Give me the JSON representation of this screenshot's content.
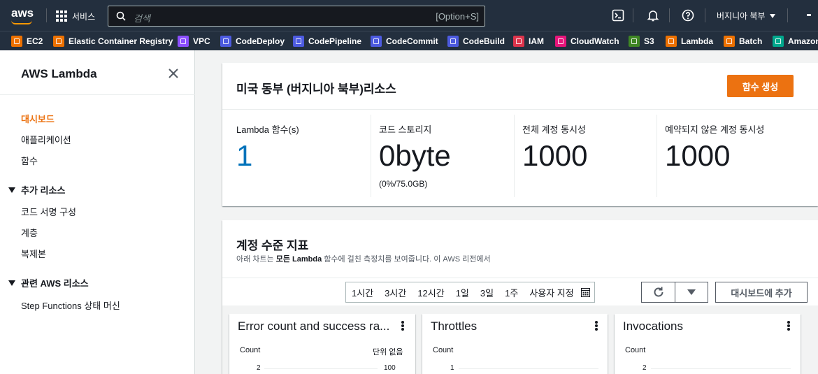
{
  "topnav": {
    "logo": "aws",
    "services_label": "서비스",
    "search_placeholder": "검색",
    "search_shortcut": "[Option+S]",
    "region_label": "버지니아 북부",
    "icons": [
      "cloudshell-icon",
      "notifications-icon",
      "help-icon"
    ]
  },
  "favorites": [
    {
      "label": "EC2",
      "color": "#ed7100"
    },
    {
      "label": "Elastic Container Registry",
      "color": "#ed7100"
    },
    {
      "label": "VPC",
      "color": "#8c4fff"
    },
    {
      "label": "CodeDeploy",
      "color": "#4d5be0"
    },
    {
      "label": "CodePipeline",
      "color": "#4d5be0"
    },
    {
      "label": "CodeCommit",
      "color": "#4d5be0"
    },
    {
      "label": "CodeBuild",
      "color": "#4d5be0"
    },
    {
      "label": "IAM",
      "color": "#dd344c"
    },
    {
      "label": "CloudWatch",
      "color": "#e7157b"
    },
    {
      "label": "S3",
      "color": "#3f8624"
    },
    {
      "label": "Lambda",
      "color": "#ed7100"
    },
    {
      "label": "Batch",
      "color": "#ed7100"
    },
    {
      "label": "Amazon",
      "color": "#01a88d"
    }
  ],
  "sidebar": {
    "title": "AWS Lambda",
    "items": [
      {
        "label": "대시보드",
        "active": true
      },
      {
        "label": "애플리케이션"
      },
      {
        "label": "함수"
      }
    ],
    "section_extra": {
      "label": "추가 리소스",
      "items": [
        {
          "label": "코드 서명 구성"
        },
        {
          "label": "계층"
        },
        {
          "label": "복제본"
        }
      ]
    },
    "section_related": {
      "label": "관련 AWS 리소스",
      "items": [
        {
          "label": "Step Functions 상태 머신"
        }
      ]
    }
  },
  "resources": {
    "title": "미국 동부 (버지니아 북부)리소스",
    "create_button": "함수 생성",
    "metrics": [
      {
        "label": "Lambda 함수(s)",
        "value": "1"
      },
      {
        "label": "코드 스토리지",
        "value": "0byte",
        "sub": "(0%/75.0GB)"
      },
      {
        "label": "전체 계정 동시성",
        "value": "1000"
      },
      {
        "label": "예약되지 않은 계정 동시성",
        "value": "1000"
      }
    ]
  },
  "account_metrics": {
    "title": "계정 수준 지표",
    "description_prefix": "아래 차트는 ",
    "description_bold": "모든 Lambda",
    "description_suffix": " 함수에 걸친 측정치를 보여줍니다. 이 AWS 리전에서",
    "time_ranges": [
      "1시간",
      "3시간",
      "12시간",
      "1일",
      "3일",
      "1주",
      "사용자 지정"
    ],
    "add_to_dashboard": "대시보드에 추가",
    "widgets": [
      {
        "title": "Error count and success ra...",
        "ylabel": "Count",
        "yrlabel": "단위 없음",
        "tick_left": "2",
        "tick_right": "100"
      },
      {
        "title": "Throttles",
        "ylabel": "Count",
        "tick_left": "1"
      },
      {
        "title": "Invocations",
        "ylabel": "Count",
        "tick_left": "2"
      }
    ]
  }
}
